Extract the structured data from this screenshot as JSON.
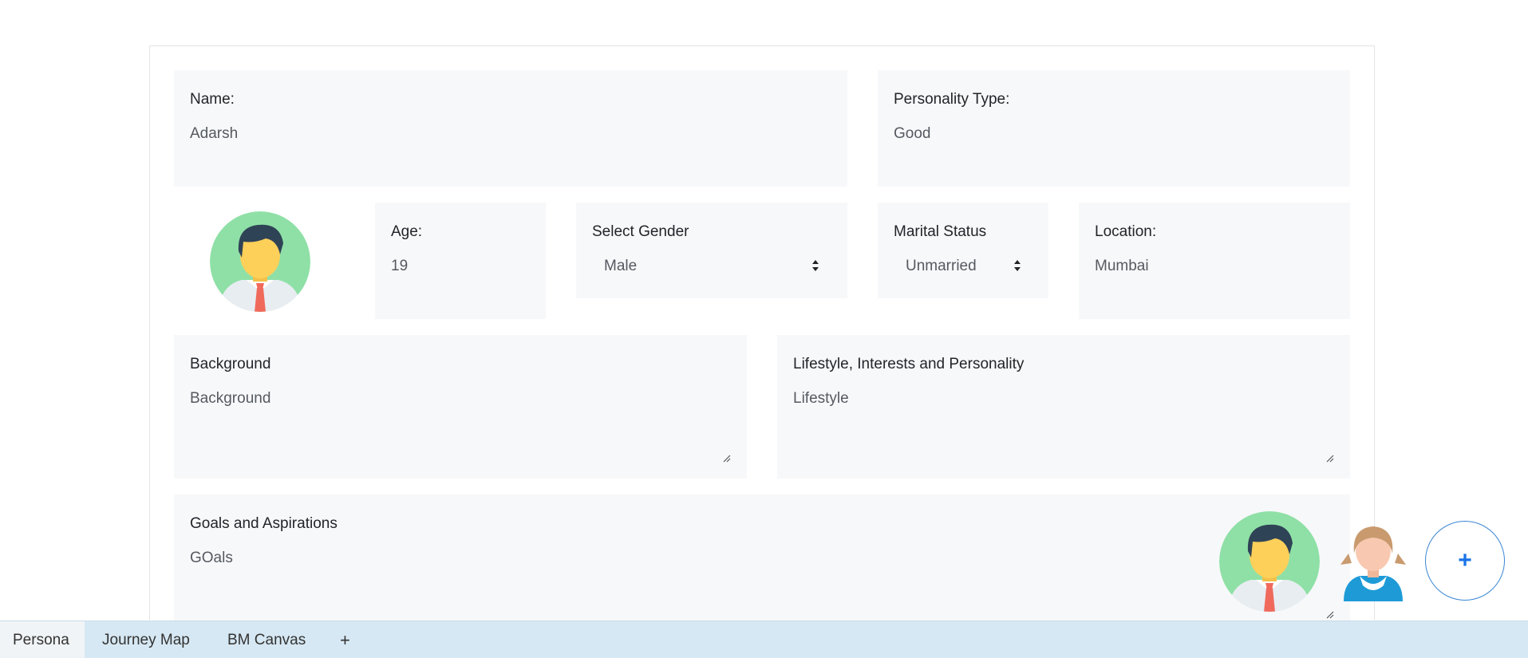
{
  "form": {
    "name": {
      "label": "Name:",
      "value": "Adarsh"
    },
    "personality_type": {
      "label": "Personality Type:",
      "value": "Good"
    },
    "age": {
      "label": "Age:",
      "value": "19"
    },
    "gender": {
      "label": "Select Gender",
      "value": "Male"
    },
    "marital_status": {
      "label": "Marital Status",
      "value": "Unmarried"
    },
    "location": {
      "label": "Location:",
      "value": "Mumbai"
    },
    "background": {
      "label": "Background",
      "value": "Background"
    },
    "lifestyle": {
      "label": "Lifestyle, Interests and Personality",
      "value": "Lifestyle"
    },
    "goals": {
      "label": "Goals and Aspirations",
      "value": "GOals"
    }
  },
  "persona_switcher": {
    "add_label": "+",
    "avatars": [
      "male-avatar",
      "female-avatar"
    ]
  },
  "tabs": [
    {
      "label": "Persona",
      "active": true
    },
    {
      "label": "Journey Map",
      "active": false
    },
    {
      "label": "BM Canvas",
      "active": false
    },
    {
      "label": "+",
      "active": false
    }
  ],
  "colors": {
    "field_bg": "#f7f8fa",
    "tabbar_bg": "#d6e8f3",
    "accent": "#1a73e8",
    "avatar_bg": "#8fe0a6"
  }
}
